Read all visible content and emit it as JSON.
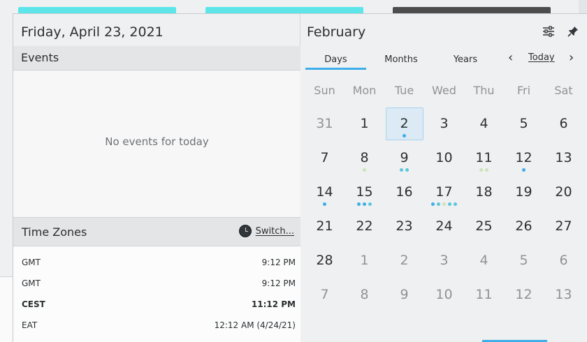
{
  "left_panel": {
    "date_title": "Friday, April 23, 2021",
    "events_header": "Events",
    "no_events_text": "No events for today",
    "timezones_header": "Time Zones",
    "switch_label": "Switch...",
    "timezones": [
      {
        "name": "GMT",
        "time": "9:12 PM",
        "bold": false
      },
      {
        "name": "GMT",
        "time": "9:12 PM",
        "bold": false
      },
      {
        "name": "CEST",
        "time": "11:12 PM",
        "bold": true
      },
      {
        "name": "EAT",
        "time": "12:12 AM (4/24/21)",
        "bold": false
      }
    ]
  },
  "right_panel": {
    "month_title": "February",
    "icons": {
      "settings": "configure-icon",
      "pin": "pin-icon"
    },
    "tabs": [
      {
        "label": "Days",
        "active": true
      },
      {
        "label": "Months",
        "active": false
      },
      {
        "label": "Years",
        "active": false
      }
    ],
    "nav": {
      "prev": "‹",
      "today": "Today",
      "next": "›"
    },
    "weekdays": [
      "Sun",
      "Mon",
      "Tue",
      "Wed",
      "Thu",
      "Fri",
      "Sat"
    ],
    "weeks": [
      [
        {
          "d": "31",
          "o": true
        },
        {
          "d": "1"
        },
        {
          "d": "2",
          "today": true,
          "dots": [
            "#3daee9"
          ]
        },
        {
          "d": "3"
        },
        {
          "d": "4"
        },
        {
          "d": "5"
        },
        {
          "d": "6"
        }
      ],
      [
        {
          "d": "7"
        },
        {
          "d": "8",
          "dots": [
            "#cde3b8"
          ]
        },
        {
          "d": "9",
          "dots": [
            "#5cc6dc",
            "#5cc6dc"
          ]
        },
        {
          "d": "10"
        },
        {
          "d": "11",
          "dots": [
            "#cde3b8",
            "#cde3b8"
          ]
        },
        {
          "d": "12",
          "dots": [
            "#3daee9"
          ]
        },
        {
          "d": "13"
        }
      ],
      [
        {
          "d": "14",
          "dots": [
            "#3daee9"
          ]
        },
        {
          "d": "15",
          "dots": [
            "#3daee9",
            "#3daee9",
            "#5cc6dc"
          ]
        },
        {
          "d": "16"
        },
        {
          "d": "17",
          "dots": [
            "#3daee9",
            "#5cc6dc",
            "#cde3b8",
            "#5cc6dc",
            "#5cc6dc"
          ]
        },
        {
          "d": "18"
        },
        {
          "d": "19"
        },
        {
          "d": "20"
        }
      ],
      [
        {
          "d": "21"
        },
        {
          "d": "22"
        },
        {
          "d": "23"
        },
        {
          "d": "24"
        },
        {
          "d": "25"
        },
        {
          "d": "26"
        },
        {
          "d": "27"
        }
      ],
      [
        {
          "d": "28"
        },
        {
          "d": "1",
          "o": true
        },
        {
          "d": "2",
          "o": true
        },
        {
          "d": "3",
          "o": true
        },
        {
          "d": "4",
          "o": true
        },
        {
          "d": "5",
          "o": true
        },
        {
          "d": "6",
          "o": true
        }
      ],
      [
        {
          "d": "7",
          "o": true
        },
        {
          "d": "8",
          "o": true
        },
        {
          "d": "9",
          "o": true
        },
        {
          "d": "10",
          "o": true
        },
        {
          "d": "11",
          "o": true
        },
        {
          "d": "12",
          "o": true
        },
        {
          "d": "13",
          "o": true
        }
      ]
    ],
    "colors": {
      "accent": "#3daee9",
      "today_bg": "#dbeaf4"
    }
  }
}
